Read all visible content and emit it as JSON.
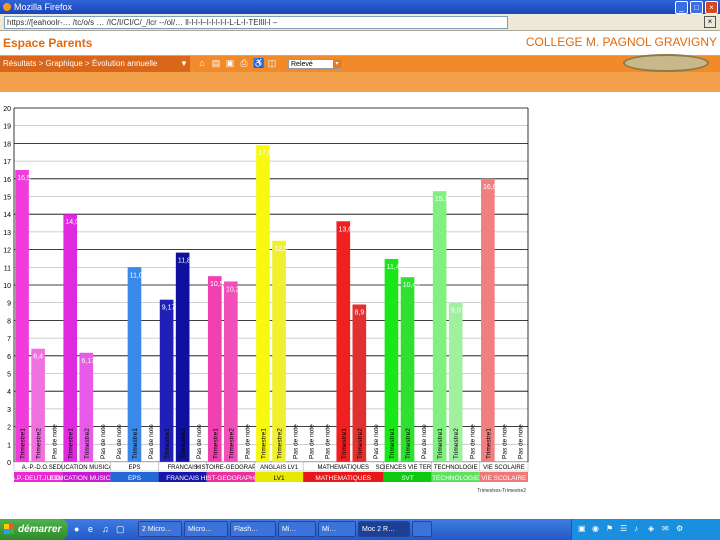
{
  "browser": {
    "title": "Mozilla Firefox",
    "url": "https://[eahoolr-… /tc/o/s … /IC/I/CI/C/_/lcr --/ol/… ll-l-l-l–I-l-l-l-l-L-L-I-TEIlll-l –",
    "window_buttons": [
      "_",
      "□",
      "×"
    ]
  },
  "app": {
    "title": "Espace Parents",
    "college": "COLLEGE M. PAGNOL GRAVIGNY"
  },
  "nav": {
    "breadcrumb": "Résultats > Graphique > Évolution annuelle",
    "toolbar_icons": [
      "home-icon",
      "print-icon",
      "save-icon",
      "printer-icon",
      "accessibility-icon",
      "export-icon"
    ],
    "select_value": "Relevé"
  },
  "chart_data": {
    "type": "bar",
    "ylim": [
      0,
      20
    ],
    "yticks": [
      0,
      1,
      2,
      3,
      4,
      5,
      6,
      7,
      8,
      9,
      10,
      11,
      12,
      13,
      14,
      15,
      16,
      17,
      18,
      19,
      20
    ],
    "groups": [
      {
        "name": "A.-P.-D.O.S.",
        "label": "A.P.-DEUT.JUDOE",
        "color": "#e82ad0",
        "bars": [
          {
            "label": "Trimestre1",
            "value": 16.5,
            "text": "16,5",
            "color": "#f03cd8"
          },
          {
            "label": "Trimestre2",
            "value": 6.4,
            "text": "6,4",
            "color": "#f070e0"
          },
          {
            "label": "Pas de note",
            "value": null,
            "text": ""
          }
        ]
      },
      {
        "name": "EDUCATION MUSICALE",
        "label": "EDUCATION MUSICALE",
        "color": "#c818d0",
        "bars": [
          {
            "label": "Trimestre1",
            "value": 14.0,
            "text": "14,0",
            "color": "#e02ae0"
          },
          {
            "label": "Trimestre2",
            "value": 6.17,
            "text": "6,17",
            "color": "#e85ae8"
          },
          {
            "label": "Pas de note",
            "value": null,
            "text": ""
          }
        ]
      },
      {
        "name": "EPS",
        "label": "EPS",
        "color": "#2468d8",
        "bars": [
          {
            "label": "Pas de note",
            "value": null,
            "text": ""
          },
          {
            "label": "Trimestre1",
            "value": 11.0,
            "text": "11,0",
            "color": "#3a88ea"
          },
          {
            "label": "Pas de note",
            "value": null,
            "text": ""
          }
        ]
      },
      {
        "name": "FRANCAIS",
        "label": "FRANCAIS",
        "color": "#1818a8",
        "bars": [
          {
            "label": "Trimestre1",
            "value": 9.17,
            "text": "9,17",
            "color": "#2020b8"
          },
          {
            "label": "Trimestre2",
            "value": 11.83,
            "text": "11,83",
            "color": "#1010a0"
          },
          {
            "label": "Pas de note",
            "value": null,
            "text": ""
          }
        ]
      },
      {
        "name": "HISTOIRE-GEOGRAPHIE",
        "label": "HIST-GEOGRAPHIE",
        "color": "#e830a0",
        "bars": [
          {
            "label": "Trimestre1",
            "value": 10.5,
            "text": "10,5",
            "color": "#f040b0"
          },
          {
            "label": "Trimestre2",
            "value": 10.2,
            "text": "10,2",
            "color": "#f050b8"
          },
          {
            "label": "Pas de note",
            "value": null,
            "text": ""
          }
        ]
      },
      {
        "name": "ANGLAIS LV1",
        "label": "LV1",
        "color": "#e8e800",
        "bars": [
          {
            "label": "Trimestre1",
            "value": 17.9,
            "text": "17,9",
            "color": "#f8f810"
          },
          {
            "label": "Trimestre2",
            "value": 12.5,
            "text": "12,5",
            "color": "#f0f030"
          },
          {
            "label": "Pas de note",
            "value": null,
            "text": ""
          }
        ]
      },
      {
        "name": "MATHEMATIQUES",
        "label": "MATHEMATIQUES",
        "color": "#e81818",
        "bars": [
          {
            "label": "Pas de note",
            "value": null,
            "text": ""
          },
          {
            "label": "Pas de note",
            "value": null,
            "text": ""
          },
          {
            "label": "Trimestre1",
            "value": 13.6,
            "text": "13,6",
            "color": "#f02020"
          },
          {
            "label": "Trimestre2",
            "value": 8.9,
            "text": "8,9",
            "color": "#e03030"
          },
          {
            "label": "Pas de note",
            "value": null,
            "text": ""
          }
        ]
      },
      {
        "name": "SCIENCES VIE TERRE",
        "label": "SVT",
        "color": "#10c810",
        "bars": [
          {
            "label": "Trimestre1",
            "value": 11.47,
            "text": "11,47",
            "color": "#18e818"
          },
          {
            "label": "Trimestre2",
            "value": 10.44,
            "text": "10,44",
            "color": "#30e030"
          },
          {
            "label": "Pas de note",
            "value": null,
            "text": ""
          }
        ]
      },
      {
        "name": "TECHNOLOGIE",
        "label": "TECHNOLOGIE",
        "color": "#60e060",
        "bars": [
          {
            "label": "Trimestre1",
            "value": 15.3,
            "text": "15,3",
            "color": "#80f080"
          },
          {
            "label": "Trimestre2",
            "value": 9.0,
            "text": "9,0",
            "color": "#a0f0a0"
          },
          {
            "label": "Pas de note",
            "value": null,
            "text": ""
          }
        ]
      },
      {
        "name": "VIE SCOLAIRE",
        "label": "VIE SCOLAIRE",
        "color": "#f07878",
        "bars": [
          {
            "label": "Trimestre1",
            "value": 16.0,
            "text": "16,0",
            "color": "#f08080"
          },
          {
            "label": "Pas de note",
            "value": null,
            "text": ""
          },
          {
            "label": "Pas de note",
            "value": null,
            "text": ""
          }
        ]
      }
    ],
    "footer_note": "Trimestres-Trimestre2"
  },
  "taskbar": {
    "start_label": "démarrer",
    "tasks": [
      {
        "label": "2 Micro…",
        "active": false
      },
      {
        "label": "Micro…",
        "active": false
      },
      {
        "label": "Flash…",
        "active": false
      },
      {
        "label": "Mi…",
        "active": false
      },
      {
        "label": "Mi…",
        "active": false
      },
      {
        "label": "Moc 2 R…",
        "active": true
      },
      {
        "label": "",
        "active": false
      }
    ]
  }
}
